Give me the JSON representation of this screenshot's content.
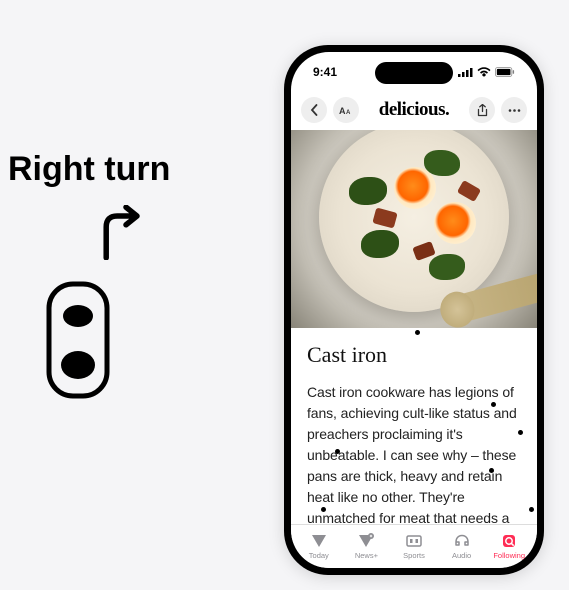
{
  "nav_hint": {
    "label": "Right turn"
  },
  "status": {
    "time": "9:41"
  },
  "header": {
    "title": "delicious."
  },
  "article": {
    "heading": "Cast iron",
    "body": "Cast iron cookware has legions of fans, achieving cult-like status and preachers proclaiming it's unbeatable. I can see why – these pans are thick, heavy and retain heat like no other. They're unmatched for meat that needs a strong sear; hav-"
  },
  "tabs": [
    {
      "id": "today",
      "label": "Today",
      "active": false
    },
    {
      "id": "newsplus",
      "label": "News+",
      "active": false
    },
    {
      "id": "sports",
      "label": "Sports",
      "active": false
    },
    {
      "id": "audio",
      "label": "Audio",
      "active": false
    },
    {
      "id": "following",
      "label": "Following",
      "active": true
    }
  ],
  "colors": {
    "accent": "#ff2d55"
  }
}
